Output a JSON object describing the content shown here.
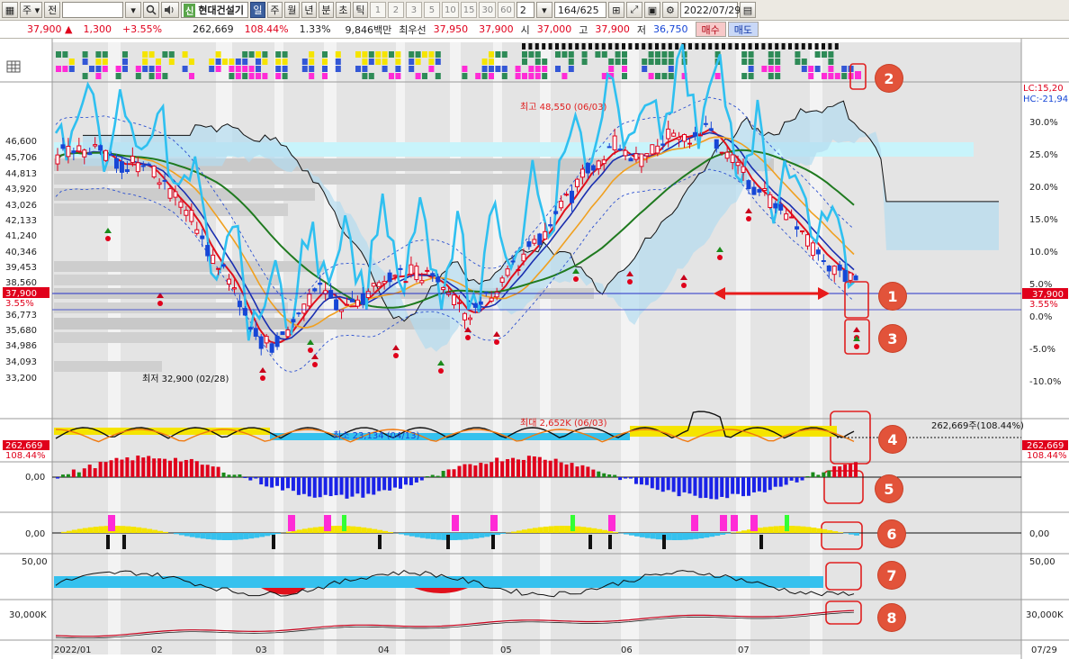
{
  "toolbar": {
    "market": "주",
    "prev_label": "전",
    "search_icon": "search-icon",
    "speaker_icon": "speaker-icon",
    "badge": "신",
    "stock_name": "현대건설기",
    "periods": [
      "일",
      "주",
      "월",
      "년",
      "분",
      "초",
      "틱"
    ],
    "active_period": "일",
    "intervals": [
      "1",
      "2",
      "3",
      "5",
      "10",
      "15",
      "30",
      "60"
    ],
    "interval_input": "2",
    "count": "164",
    "count_total": "/625",
    "date": "2022/07/29"
  },
  "quote": {
    "price": "37,900",
    "up_arrow": "▲",
    "change": "1,300",
    "change_pct": "+3.55%",
    "volume": "262,669",
    "volume_ratio": "108.44%",
    "turnover": "1.33%",
    "amount": "9,846백만",
    "best_ask_label": "최우선",
    "best_ask": "37,950",
    "best_bid": "37,900",
    "open_label": "시",
    "open": "37,000",
    "high_label": "고",
    "high": "37,900",
    "low_label": "저",
    "low": "36,750",
    "buy_label": "매수",
    "sell_label": "매도"
  },
  "price_axis": {
    "left_ticks": [
      "46,600",
      "45,706",
      "44,813",
      "43,920",
      "43,026",
      "42,133",
      "41,240",
      "40,346",
      "39,453",
      "38,560",
      "37,900",
      "3.55%",
      "36,773",
      "35,680",
      "34,986",
      "34,093",
      "33,200"
    ],
    "right_ticks": [
      "30.0%",
      "25.0%",
      "20.0%",
      "15.0%",
      "10.0%",
      "5.0%",
      "0.0%",
      "-5.0%",
      "-10.0%"
    ],
    "right_price": "37,900",
    "right_pct": "3.55%",
    "lc": "LC:15,20",
    "hc": "HC:-21,94"
  },
  "annotations": {
    "high_label": "최고 48,550 (06/03)",
    "low_label": "최저 32,900 (02/28)",
    "vol_max": "최대 2,652K (06/03)",
    "vol_min": "최소 23,134 (04/13)",
    "vol_current": "262,669주(108.44%)"
  },
  "volume_axis": {
    "left_value": "262,669",
    "left_pct": "108.44%",
    "right_value": "262,669",
    "right_pct": "108.44%"
  },
  "sub_axes": {
    "macd_left": "0,00",
    "osc_left": "0,00",
    "osc_right": "0,00",
    "rsi_left": "50,00",
    "rsi_right": "50,00",
    "obv_left": "30,000K",
    "obv_right": "30,000K"
  },
  "x_axis": {
    "labels": [
      "2022/01",
      "02",
      "03",
      "04",
      "05",
      "06",
      "07"
    ],
    "end_label": "07/29"
  },
  "markers": [
    "1",
    "2",
    "3",
    "4",
    "5",
    "6",
    "7",
    "8"
  ],
  "colors": {
    "up": "#e0001b",
    "down": "#1646d6",
    "marker": "#e2533a",
    "callout": "#e02020"
  }
}
